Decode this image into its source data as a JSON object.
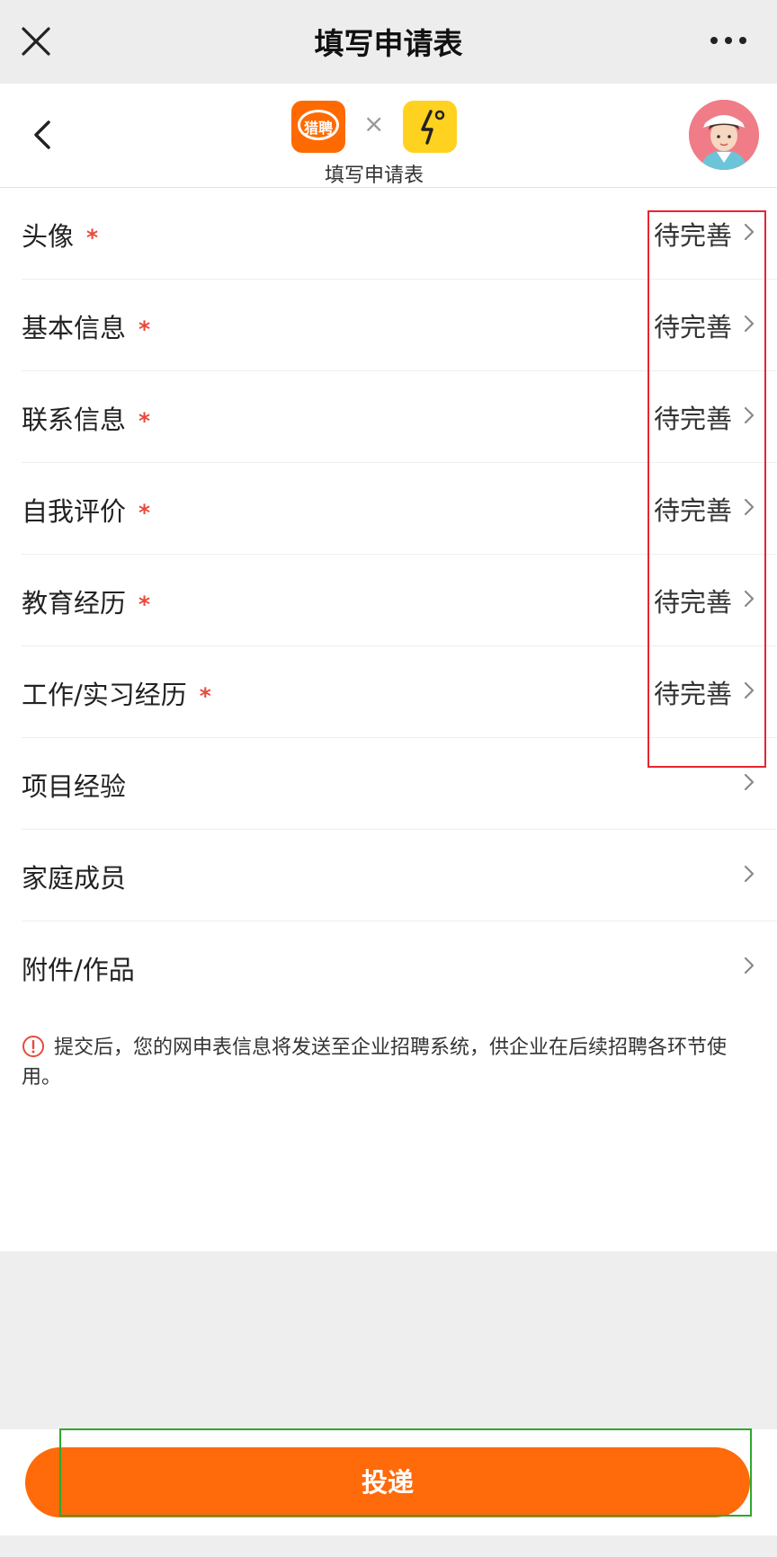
{
  "topbar": {
    "title": "填写申请表"
  },
  "header": {
    "x_mark": "×",
    "logo_text": "猎聘",
    "subtitle": "填写申请表"
  },
  "form": {
    "rows": [
      {
        "label": "头像",
        "required": "*",
        "status": "待完善"
      },
      {
        "label": "基本信息",
        "required": "*",
        "status": "待完善"
      },
      {
        "label": "联系信息",
        "required": "*",
        "status": "待完善"
      },
      {
        "label": "自我评价",
        "required": "*",
        "status": "待完善"
      },
      {
        "label": "教育经历",
        "required": "*",
        "status": "待完善"
      },
      {
        "label": "工作/实习经历",
        "required": "*",
        "status": "待完善"
      },
      {
        "label": "项目经验",
        "required": "",
        "status": ""
      },
      {
        "label": "家庭成员",
        "required": "",
        "status": ""
      },
      {
        "label": "附件/作品",
        "required": "",
        "status": ""
      }
    ],
    "notice": "提交后，您的网申表信息将发送至企业招聘系统，供企业在后续招聘各环节使用。"
  },
  "submit": {
    "label": "投递"
  },
  "colors": {
    "accent": "#ff6a0a",
    "required_star": "#e84a3c",
    "highlight_red": "#e8242f",
    "highlight_green": "#2ea82e",
    "logo_partner": "#ffd21f"
  }
}
